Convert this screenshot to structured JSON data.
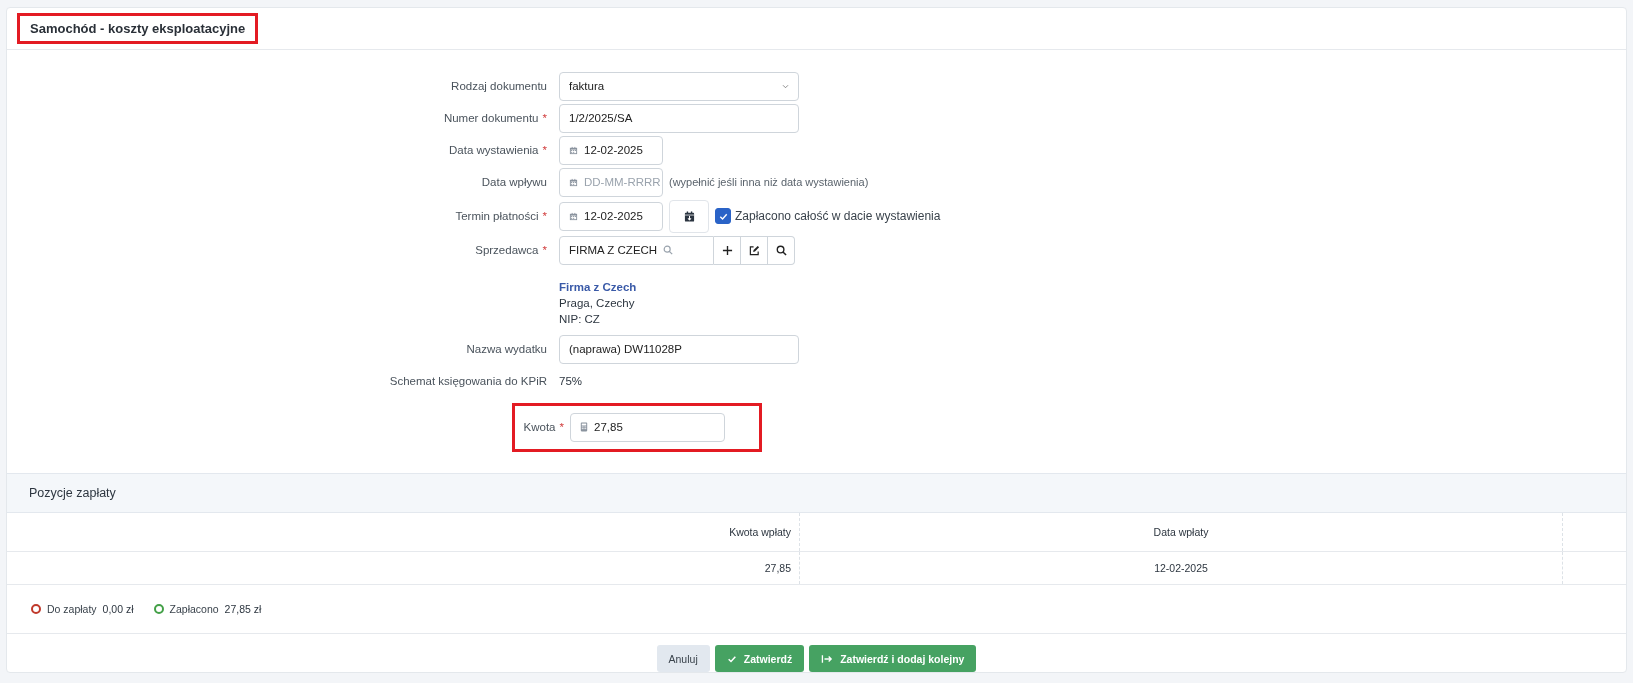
{
  "header": {
    "title": "Samochód - koszty eksploatacyjne",
    "highlighted": true
  },
  "form": {
    "fields": [
      {
        "kind": "select",
        "label": "Rodzaj dokumentu",
        "value": "faktura"
      },
      {
        "kind": "text",
        "label": "Numer dokumentu",
        "required_mark": "*",
        "value": "1/2/2025/SA"
      },
      {
        "kind": "date",
        "label": "Data wystawienia",
        "required_mark": "*",
        "value": "12-02-2025"
      },
      {
        "kind": "date",
        "label": "Data wpływu",
        "placeholder": "DD-MM-RRRR",
        "hint": "(wypełnić jeśli inna niż data wystawienia)"
      },
      {
        "kind": "date_paid",
        "label": "Termin płatności",
        "required_mark": "*",
        "value": "12-02-2025",
        "checkbox": {
          "label": "Zapłacono całość w dacie wystawienia",
          "checked": true
        }
      },
      {
        "kind": "seller",
        "label": "Sprzedawca",
        "required_mark": "*",
        "value": "FIRMA Z CZECH",
        "seller": {
          "name": "Firma z Czech",
          "address": "Praga, Czechy",
          "nip": "NIP: CZ"
        }
      },
      {
        "kind": "text",
        "label": "Nazwa wydatku",
        "value": "(naprawa) DW11028P"
      },
      {
        "kind": "static",
        "label": "Schemat księgowania do KPiR",
        "value": "75%"
      },
      {
        "kind": "amount",
        "label": "Kwota",
        "required_mark": "*",
        "value": "27,85",
        "highlighted": true
      }
    ]
  },
  "payments": {
    "title": "Pozycje zapłaty",
    "columns": [
      "Kwota wpłaty",
      "Data wpłaty"
    ],
    "rows": [
      [
        "27,85",
        "12-02-2025"
      ]
    ]
  },
  "summary": [
    {
      "label": "Do zapłaty",
      "value": "0,00 zł",
      "color": "#c0392b"
    },
    {
      "label": "Zapłacono",
      "value": "27,85 zł",
      "color": "#43a047"
    }
  ],
  "buttons": [
    {
      "kind": "cancel",
      "label": "Anuluj"
    },
    {
      "kind": "confirm",
      "label": "Zatwierdź"
    },
    {
      "kind": "confirm_next",
      "label": "Zatwierdź i dodaj kolejny"
    }
  ]
}
